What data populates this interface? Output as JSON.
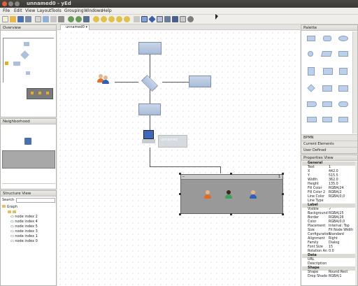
{
  "window": {
    "title": "unnamed0 - yEd"
  },
  "menu": [
    "File",
    "Edit",
    "View",
    "Layout",
    "Tools",
    "Grouping",
    "Windows",
    "Help"
  ],
  "doc_tab": {
    "label": "unnamed0"
  },
  "overview": {
    "title": "Overview"
  },
  "neighborhood": {
    "title": "Neighborhood"
  },
  "structure": {
    "title": "Structure View",
    "search_label": "Search",
    "root": "Graph",
    "items": [
      "node index 2",
      "node index 4",
      "node index 5",
      "node index 3",
      "node index 1",
      "node index 0"
    ]
  },
  "palette": {
    "title": "Palette",
    "sections": [
      "BPMN",
      "Current Elements",
      "User Defined"
    ]
  },
  "properties": {
    "title": "Properties View",
    "sections": {
      "general": "General",
      "label": "Label",
      "data": "Data",
      "shape": "Shape"
    },
    "general": [
      [
        "Text",
        "1"
      ],
      [
        "X",
        "442.0"
      ],
      [
        "Y",
        "515.5"
      ],
      [
        "Width",
        "362.0"
      ],
      [
        "Height",
        "135.0"
      ],
      [
        "Fill Color",
        "RGBA(24"
      ],
      [
        "Fill Color 2",
        "RGBA(2"
      ],
      [
        "Line Color",
        "RGBA(0,0"
      ],
      [
        "Line Type",
        ""
      ]
    ],
    "label": [
      [
        "Visible",
        "✓"
      ],
      [
        "Background",
        "RGBA(25"
      ],
      [
        "Border",
        "RGBA(26"
      ],
      [
        "Color",
        "RGBA(0,0"
      ],
      [
        "Placement",
        "Internal: Top"
      ],
      [
        "Size",
        "Fit Node Width"
      ],
      [
        "Configuration",
        "Standard"
      ],
      [
        "Alignment",
        "Right"
      ],
      [
        "Family",
        "Dialog"
      ],
      [
        "Font Size",
        "15"
      ],
      [
        "Rotation An",
        "0.0"
      ]
    ],
    "data": [
      [
        "URL",
        ""
      ],
      [
        "Description",
        ""
      ]
    ],
    "shape": [
      [
        "Shape",
        "Round Rect"
      ],
      [
        "Drop Shado",
        "RGBA(1"
      ]
    ]
  },
  "canvas": {
    "group_label": "1",
    "group_minimize": "–",
    "selected_label": "unnamed"
  },
  "colors": {
    "node_fill": "#bccde6",
    "group_fill": "#999999",
    "selection": "#6f86b8"
  }
}
